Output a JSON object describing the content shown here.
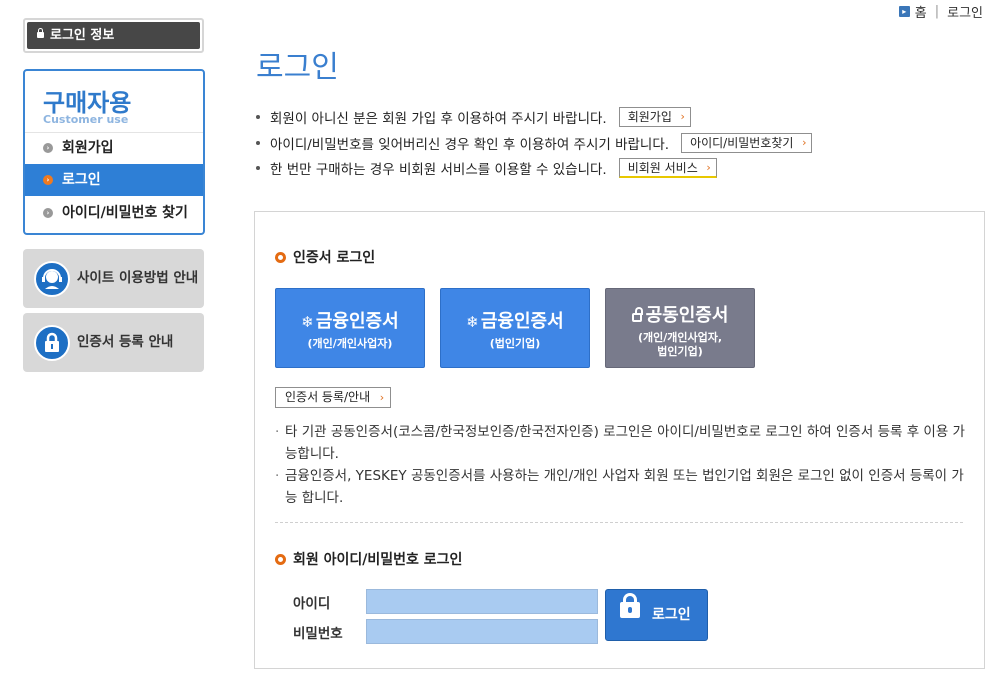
{
  "breadcrumb": {
    "home": "홈",
    "current": "로그인"
  },
  "sidebar": {
    "login_info_label": "로그인 정보",
    "menu_title": "구매자용",
    "menu_subtitle": "Customer use",
    "items": [
      {
        "label": "회원가입",
        "active": false
      },
      {
        "label": "로그인",
        "active": true
      },
      {
        "label": "아이디/비밀번호 찾기",
        "active": false
      }
    ],
    "guides": [
      {
        "label": "사이트 이용방법 안내",
        "icon": "support-agent-icon"
      },
      {
        "label": "인증서 등록 안내",
        "icon": "lock-icon"
      }
    ]
  },
  "main": {
    "title": "로그인",
    "notices": [
      {
        "text": "회원이 아니신 분은 회원 가입 후 이용하여 주시기 바랍니다.",
        "button": "회원가입"
      },
      {
        "text": "아이디/비밀번호를 잊어버리신 경우 확인 후 이용하여 주시기 바랍니다.",
        "button": "아이디/비밀번호찾기"
      },
      {
        "text": "한 번만 구매하는 경우 비회원 서비스를 이용할 수 있습니다.",
        "button": "비회원 서비스"
      }
    ],
    "cert_section": {
      "title": "인증서 로그인",
      "buttons": [
        {
          "title": "금융인증서",
          "sub": "(개인/개인사업자)"
        },
        {
          "title": "금융인증서",
          "sub": "(법인기업)"
        },
        {
          "title": "공동인증서",
          "sub_line1": "(개인/개인사업자,",
          "sub_line2": "법인기업)"
        }
      ],
      "register_button": "인증서 등록/안내",
      "info": [
        "타 기관 공동인증서(코스콤/한국정보인증/한국전자인증) 로그인은 아이디/비밀번호로 로그인 하여 인증서 등록 후 이용 가능합니다.",
        "금융인증서, YESKEY 공동인증서를 사용하는 개인/개인 사업자 회원 또는 법인기업 회원은 로그인 없이 인증서 등록이 가능 합니다."
      ]
    },
    "id_section": {
      "title": "회원 아이디/비밀번호 로그인",
      "id_label": "아이디",
      "pw_label": "비밀번호",
      "id_value": "",
      "pw_value": "",
      "login_button": "로그인"
    }
  },
  "colors": {
    "accent_blue": "#3a7fcf",
    "active_menu": "#2e7fd6",
    "orange": "#e46b12",
    "cert_blue": "#3f86e6",
    "cert_gray": "#797b8c",
    "input_fill": "#a9cbf1"
  }
}
